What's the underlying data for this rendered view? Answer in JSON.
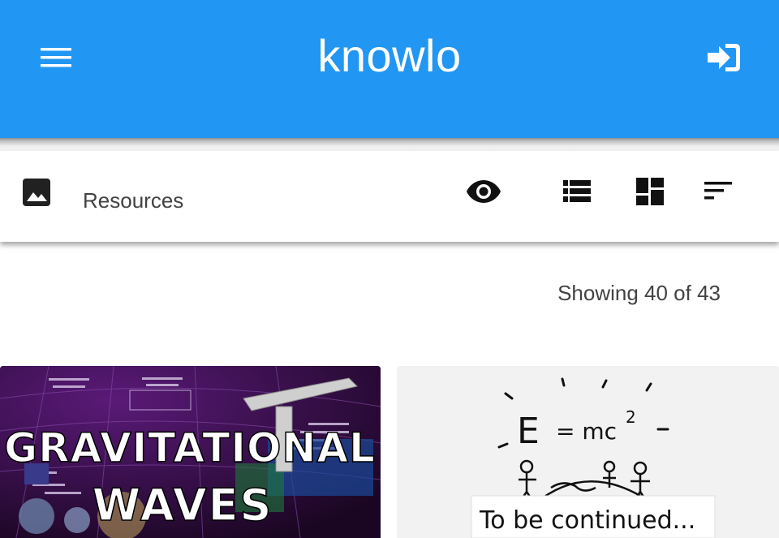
{
  "app": {
    "title": "knowlo",
    "menu_icon": "menu-icon",
    "login_icon": "login-icon",
    "accent": "#2196f3"
  },
  "toolbar": {
    "type_icon": "image-icon",
    "title": "Resources",
    "actions": [
      {
        "icon": "eye-icon"
      },
      {
        "icon": "list-view-icon"
      },
      {
        "icon": "dashboard-view-icon"
      },
      {
        "icon": "sort-icon"
      }
    ]
  },
  "results": {
    "count_text": "Showing 40 of 43"
  },
  "cards": [
    {
      "thumbnail_text": "GRAVITATIONAL WAVES"
    },
    {
      "thumbnail_text": "E = mc²  To be continued..."
    }
  ]
}
